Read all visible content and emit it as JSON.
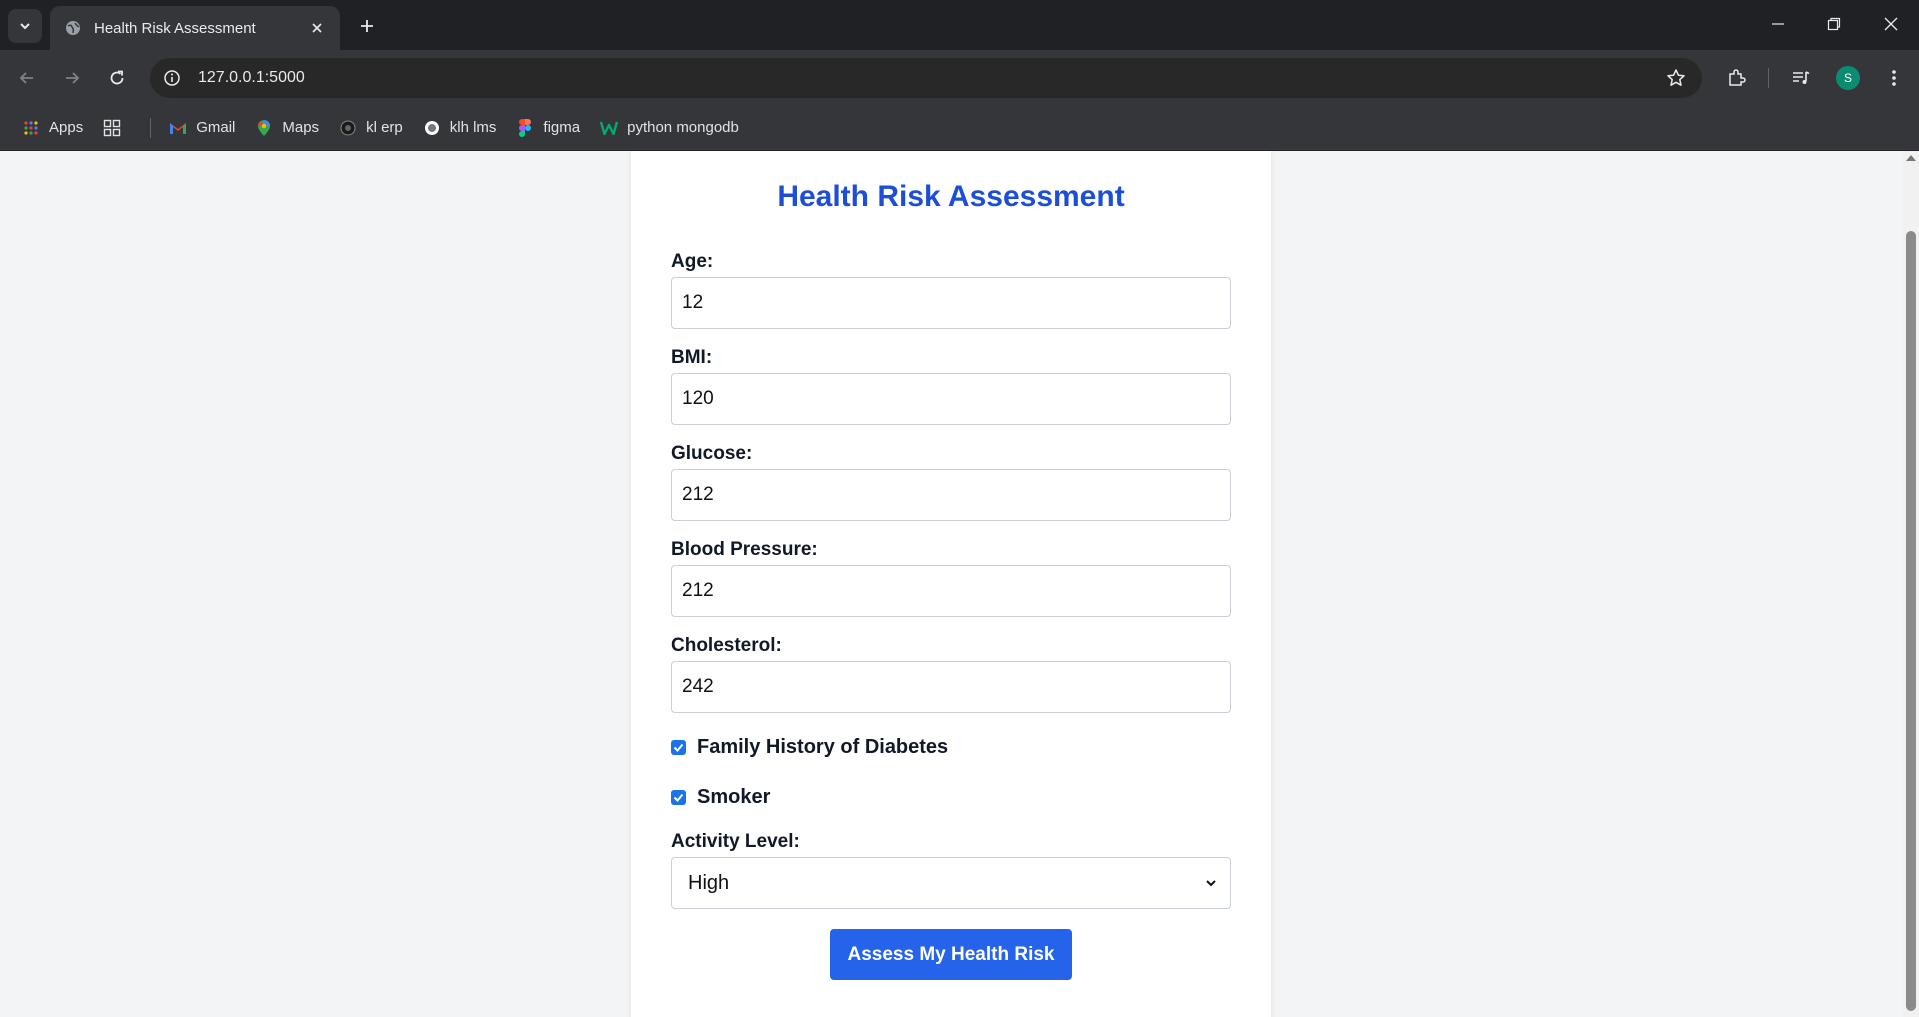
{
  "browser": {
    "tab_title": "Health Risk Assessment",
    "url": "127.0.0.1:5000",
    "profile_initial": "S",
    "bookmarks": [
      {
        "label": "Apps"
      },
      {
        "label": "Gmail"
      },
      {
        "label": "Maps"
      },
      {
        "label": "kl erp"
      },
      {
        "label": "klh lms"
      },
      {
        "label": "figma"
      },
      {
        "label": "python mongodb"
      }
    ]
  },
  "page": {
    "title": "Health Risk Assessment",
    "fields": {
      "age": {
        "label": "Age:",
        "value": "12"
      },
      "bmi": {
        "label": "BMI:",
        "value": "120"
      },
      "glucose": {
        "label": "Glucose:",
        "value": "212"
      },
      "blood_pressure": {
        "label": "Blood Pressure:",
        "value": "212"
      },
      "cholesterol": {
        "label": "Cholesterol:",
        "value": "242"
      }
    },
    "checkboxes": {
      "family_history": {
        "label": "Family History of Diabetes",
        "checked": true
      },
      "smoker": {
        "label": "Smoker",
        "checked": true
      }
    },
    "activity": {
      "label": "Activity Level:",
      "selected": "High"
    },
    "submit_label": "Assess My Health Risk"
  },
  "colors": {
    "accent": "#2563eb",
    "heading": "#1d4ed8",
    "page_bg": "#f3f4f6",
    "chrome_bg": "#202124"
  }
}
